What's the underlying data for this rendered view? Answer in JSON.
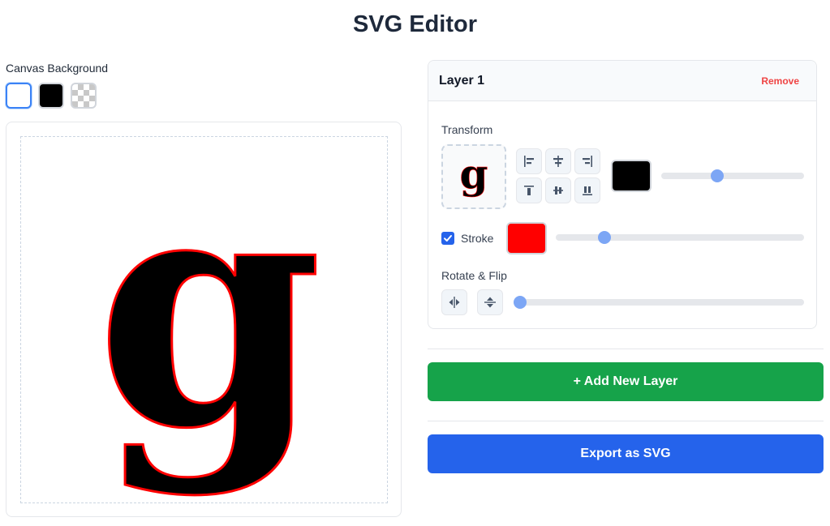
{
  "app": {
    "title": "SVG Editor"
  },
  "canvas": {
    "background_label": "Canvas Background",
    "backgrounds": [
      {
        "name": "white",
        "color": "#ffffff",
        "selected": true
      },
      {
        "name": "black",
        "color": "#000000",
        "selected": false
      },
      {
        "name": "transparent",
        "color": "checkerboard",
        "selected": false
      }
    ],
    "glyph": "g"
  },
  "layer": {
    "name": "Layer 1",
    "remove_label": "Remove",
    "transform_label": "Transform",
    "align_buttons": [
      "align-left-icon",
      "align-center-horizontal-icon",
      "align-right-icon",
      "align-top-icon",
      "align-middle-vertical-icon",
      "align-bottom-icon"
    ],
    "fill_color": "#000000",
    "scale_fraction": 0.38,
    "stroke": {
      "enabled": true,
      "label": "Stroke",
      "color": "#ff0000",
      "width_fraction": 0.18
    },
    "rotate_label": "Rotate & Flip",
    "flip_buttons": [
      "flip-horizontal-icon",
      "flip-vertical-icon"
    ],
    "rotation_fraction": 0
  },
  "actions": {
    "add_layer_label": "+ Add New Layer",
    "export_label": "Export as SVG"
  },
  "colors": {
    "accent": "#2563eb",
    "success": "#16a34a",
    "danger": "#ef4444"
  }
}
